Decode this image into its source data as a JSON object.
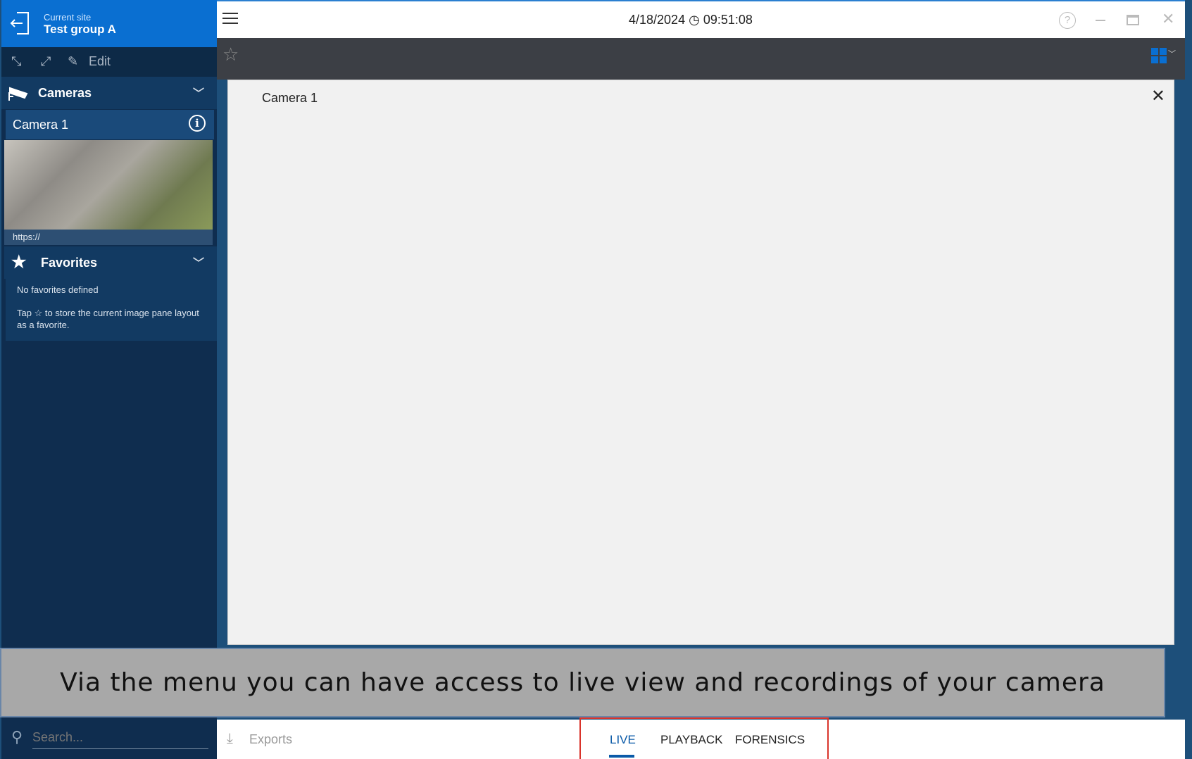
{
  "site": {
    "label": "Current site",
    "name": "Test group A"
  },
  "tools": {
    "edit": "Edit"
  },
  "cameras": {
    "title": "Cameras",
    "items": [
      {
        "name": "Camera 1",
        "url": "https://"
      }
    ]
  },
  "favorites": {
    "title": "Favorites",
    "empty": "No favorites defined",
    "hint_pre": "Tap",
    "hint_post": "to store the current image pane layout as a favorite."
  },
  "header": {
    "date": "4/18/2024",
    "time": "09:51:08"
  },
  "pane": {
    "title": "Camera 1"
  },
  "caption": "Via the menu you can have access to live view and recordings of your camera",
  "bottom": {
    "search_placeholder": "Search...",
    "exports": "Exports",
    "modes": [
      "LIVE",
      "PLAYBACK",
      "FORENSICS"
    ],
    "active_mode": "LIVE"
  },
  "colors": {
    "accent": "#0a6fd1",
    "sidebar": "#0f2d4f",
    "highlight": "#d9342b"
  }
}
